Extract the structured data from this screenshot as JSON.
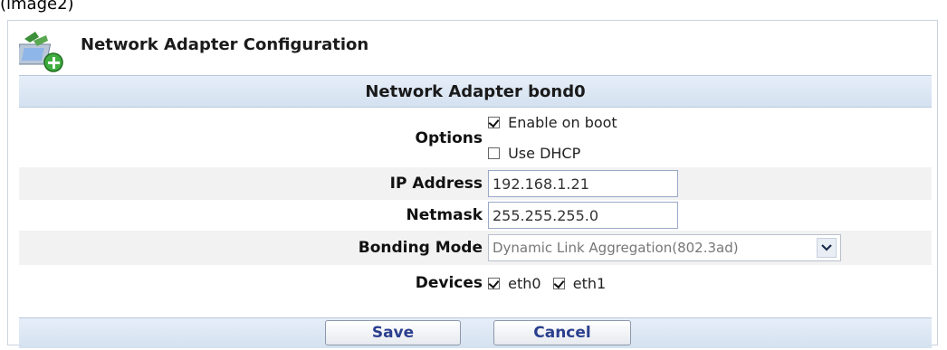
{
  "caption": "(image2)",
  "window": {
    "title": "Network Adapter Configuration",
    "icon": "network-adapter-icon"
  },
  "section": {
    "title": "Network Adapter bond0"
  },
  "options": {
    "label": "Options",
    "enable_on_boot": {
      "label": "Enable on boot",
      "checked": true
    },
    "use_dhcp": {
      "label": "Use DHCP",
      "checked": false
    }
  },
  "ip_address": {
    "label": "IP Address",
    "value": "192.168.1.21"
  },
  "netmask": {
    "label": "Netmask",
    "value": "255.255.255.0"
  },
  "bonding_mode": {
    "label": "Bonding Mode",
    "value": "Dynamic Link Aggregation(802.3ad)"
  },
  "devices": {
    "label": "Devices",
    "items": [
      {
        "label": "eth0",
        "checked": true
      },
      {
        "label": "eth1",
        "checked": true
      }
    ]
  },
  "buttons": {
    "save": "Save",
    "cancel": "Cancel"
  }
}
